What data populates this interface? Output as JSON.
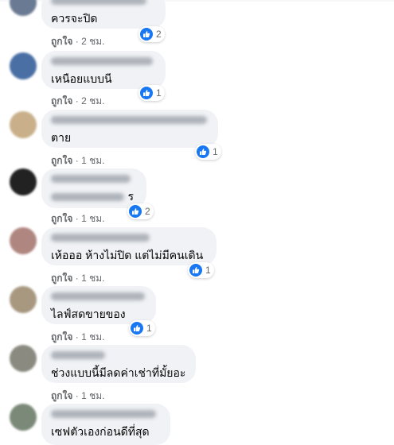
{
  "comments": [
    {
      "text": "ควรจะปิด",
      "like": "ถูกใจ",
      "time": "2 ชม.",
      "reactions": "2"
    },
    {
      "text": "เหนือยแบบนี",
      "like": "ถูกใจ",
      "time": "2 ชม.",
      "reactions": "1"
    },
    {
      "text": "ตาย",
      "like": "ถูกใจ",
      "time": "1 ชม.",
      "reactions": "1"
    },
    {
      "text": "ร",
      "like": "ถูกใจ",
      "time": "1 ชม.",
      "reactions": "2"
    },
    {
      "text": "เห้อออ ห้างไม่ปิด แต่ไม่มีคนเดิน",
      "like": "ถูกใจ",
      "time": "1 ชม.",
      "reactions": "1"
    },
    {
      "text": "ไลฟ์สดขายของ",
      "like": "ถูกใจ",
      "time": "1 ชม.",
      "reactions": "1"
    },
    {
      "text": "ช่วงแบบนี้มีลดค่าเช่าที่มั้ยอะ",
      "like": "ถูกใจ",
      "time": "1 ชม.",
      "reactions": ""
    },
    {
      "text": "เซฟตัวเองก่อนดีที่สุด",
      "like": "",
      "time": "",
      "reactions": ""
    }
  ],
  "icons": {
    "like": "thumbs-up-icon"
  },
  "colors": {
    "like_blue": "#1877f2",
    "bubble": "#f0f2f5",
    "meta_text": "#65676b"
  }
}
